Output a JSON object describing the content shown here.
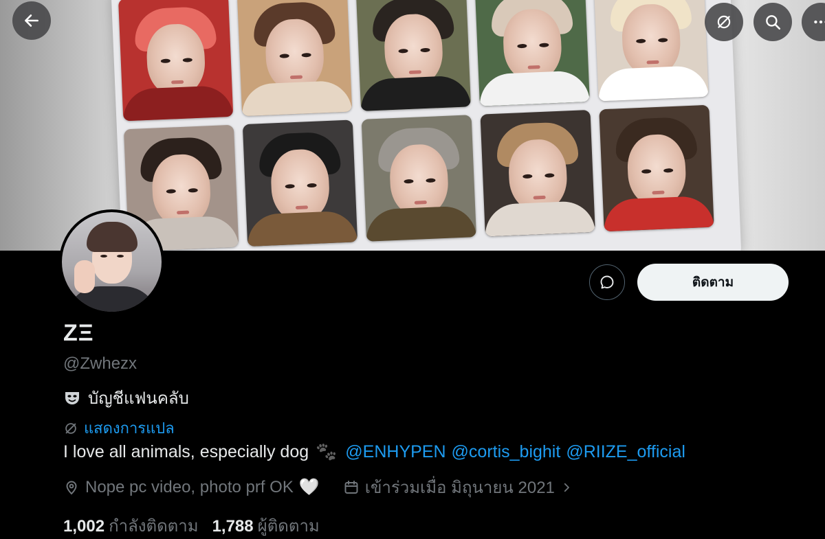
{
  "header": {
    "back_icon": "arrow-left-icon",
    "actions": [
      "translate-off-icon",
      "search-icon",
      "more-icon"
    ]
  },
  "profile": {
    "display_name": "ZΞ",
    "handle": "@Zwhezx",
    "account_label": "บัญชีแฟนคลับ",
    "account_label_icon": "theater-mask-icon",
    "translate_label": "แสดงการแปล",
    "bio_text": "I love all animals, especially dog",
    "bio_emoji": "🐾",
    "mentions": [
      "@ENHYPEN",
      "@cortis_bighit",
      "@RIIZE_official"
    ],
    "location": "Nope pc video, photo prf OK",
    "location_emoji": "🤍",
    "joined": "เข้าร่วมเมื่อ มิถุนายน 2021"
  },
  "actions": {
    "follow_label": "ติดตาม",
    "message_icon": "message-bubble-icon"
  },
  "stats": {
    "following_count": "1,002",
    "following_label": "กำลังติดตาม",
    "followers_count": "1,788",
    "followers_label": "ผู้ติดตาม"
  },
  "colors": {
    "background": "#000000",
    "text_primary": "#e7e9ea",
    "text_secondary": "#71767b",
    "link": "#1d9bf0",
    "follow_button_bg": "#eff3f4"
  }
}
